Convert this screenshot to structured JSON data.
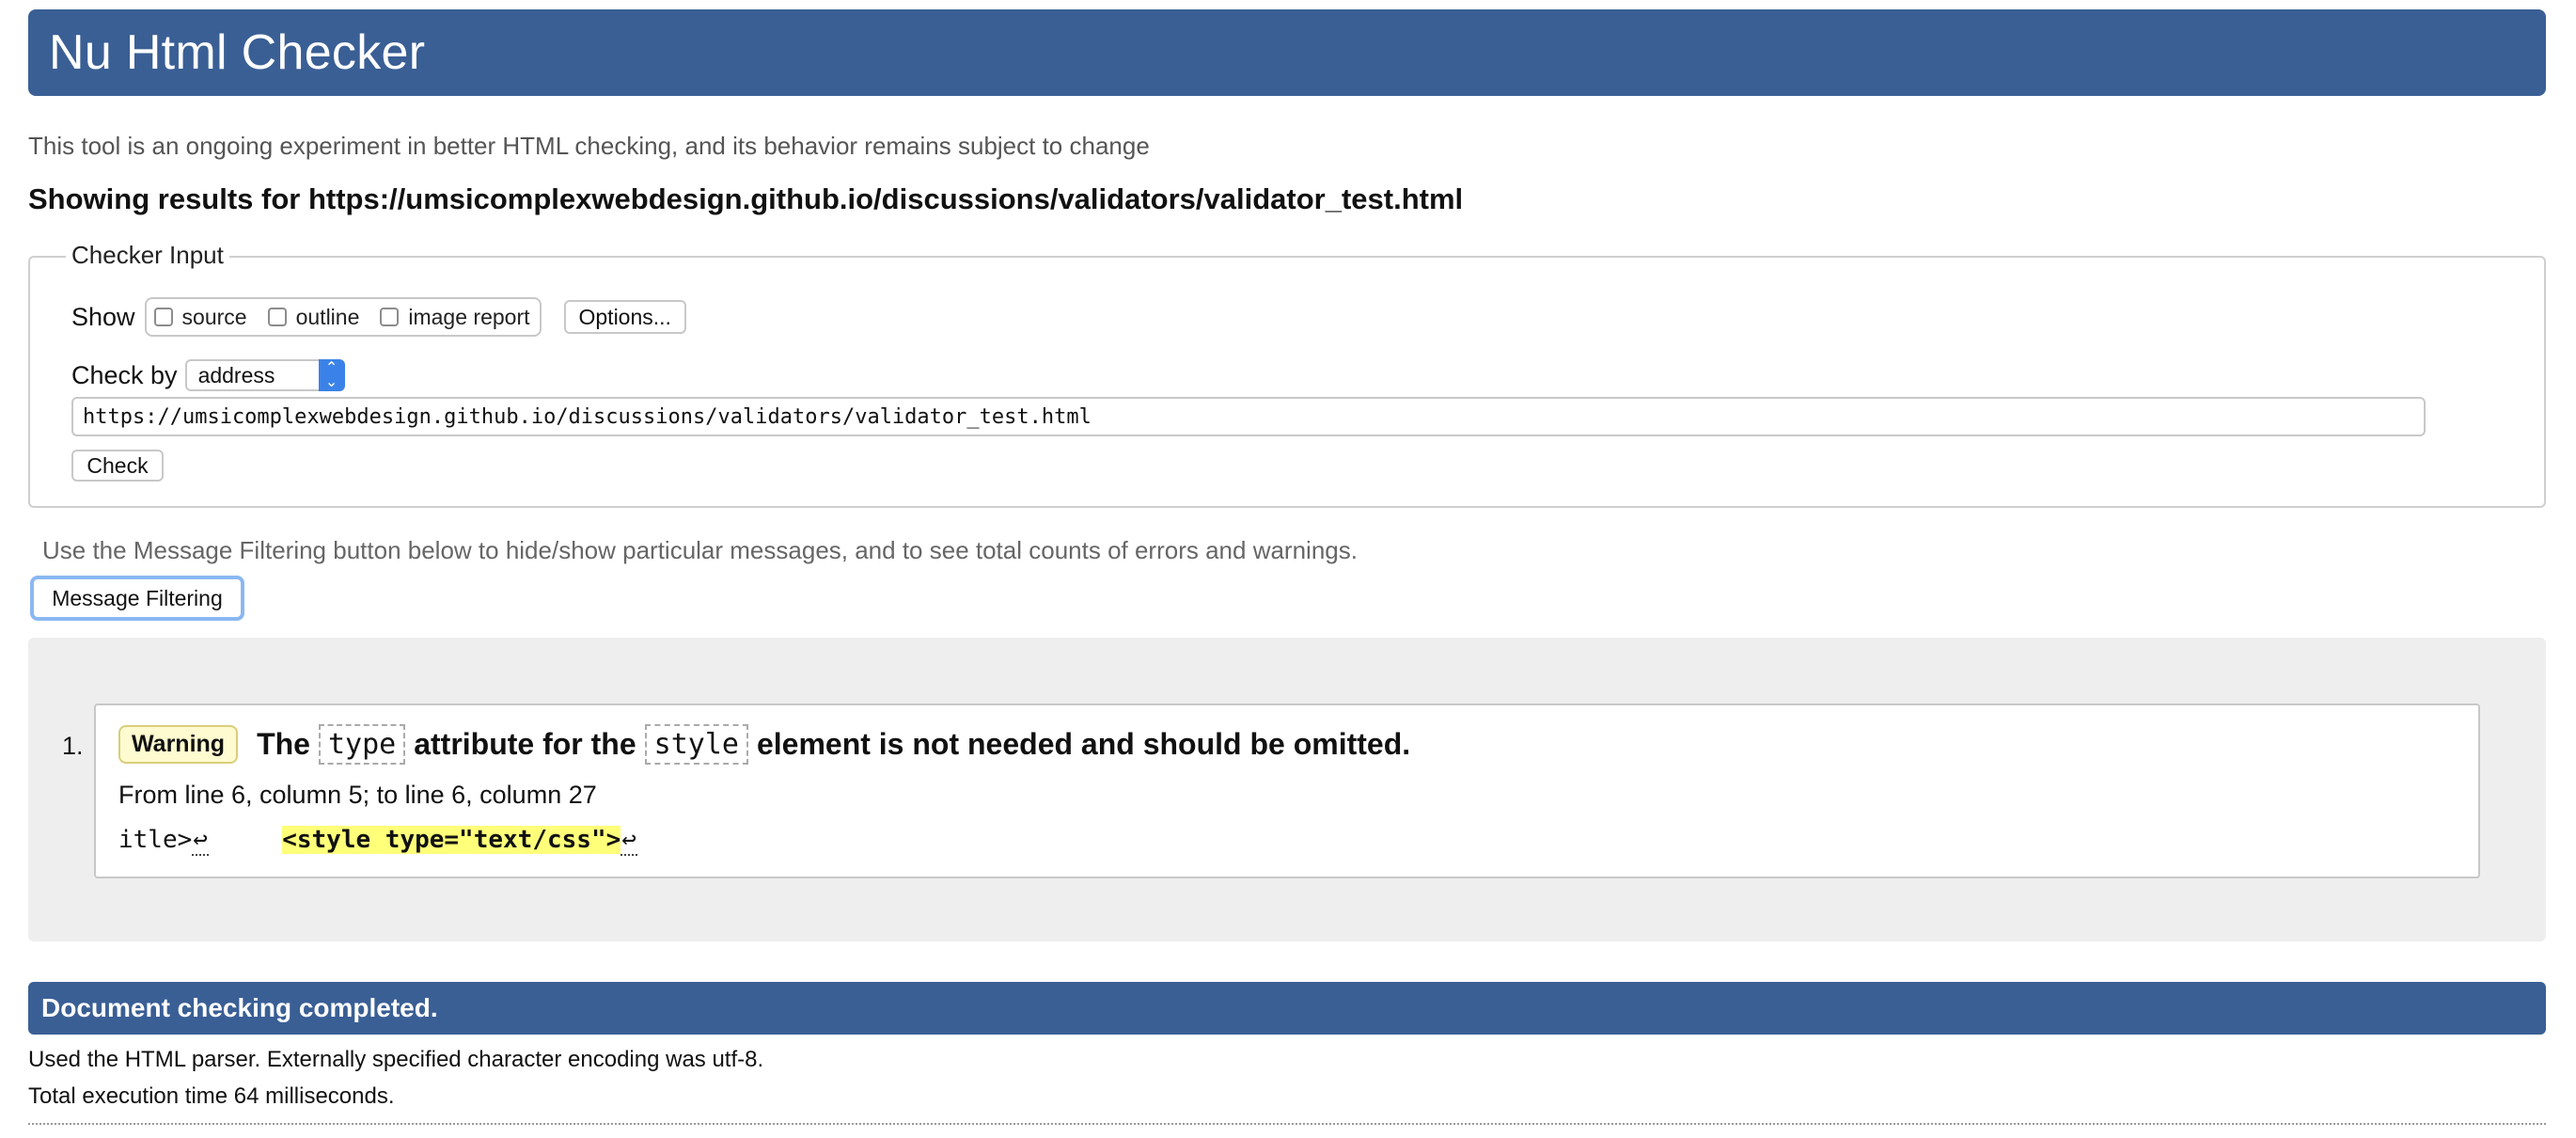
{
  "header": {
    "title": "Nu Html Checker"
  },
  "intro": "This tool is an ongoing experiment in better HTML checking, and its behavior remains subject to change",
  "showing": "Showing results for https://umsicomplexwebdesign.github.io/discussions/validators/validator_test.html",
  "checker_input": {
    "legend": "Checker Input",
    "show_label": "Show",
    "show_options": [
      "source",
      "outline",
      "image report"
    ],
    "options_button": "Options...",
    "check_by_label": "Check by",
    "check_by_value": "address",
    "url_value": "https://umsicomplexwebdesign.github.io/discussions/validators/validator_test.html",
    "check_button": "Check"
  },
  "filter": {
    "note": "Use the Message Filtering button below to hide/show particular messages, and to see total counts of errors and warnings.",
    "button": "Message Filtering"
  },
  "messages": [
    {
      "number": "1.",
      "badge": "Warning",
      "text_parts": [
        "The",
        "type",
        "attribute for the",
        "style",
        "element is not needed and should be omitted."
      ],
      "location": "From line 6, column 5; to line 6, column 27",
      "extract_before": "itle>",
      "extract_gap": "     ",
      "extract_highlight": "<style type=\"text/css\">",
      "newline_glyph": "↩"
    }
  ],
  "footer": {
    "completed": "Document checking completed.",
    "parser_note": "Used the HTML parser. Externally specified character encoding was utf-8.",
    "exec_note": "Total execution time 64 milliseconds."
  },
  "colors": {
    "banner": "#3a5f95",
    "warning_bg": "#fffbd0",
    "highlight": "#ffff7a",
    "focus_ring": "#8ab8f2"
  }
}
